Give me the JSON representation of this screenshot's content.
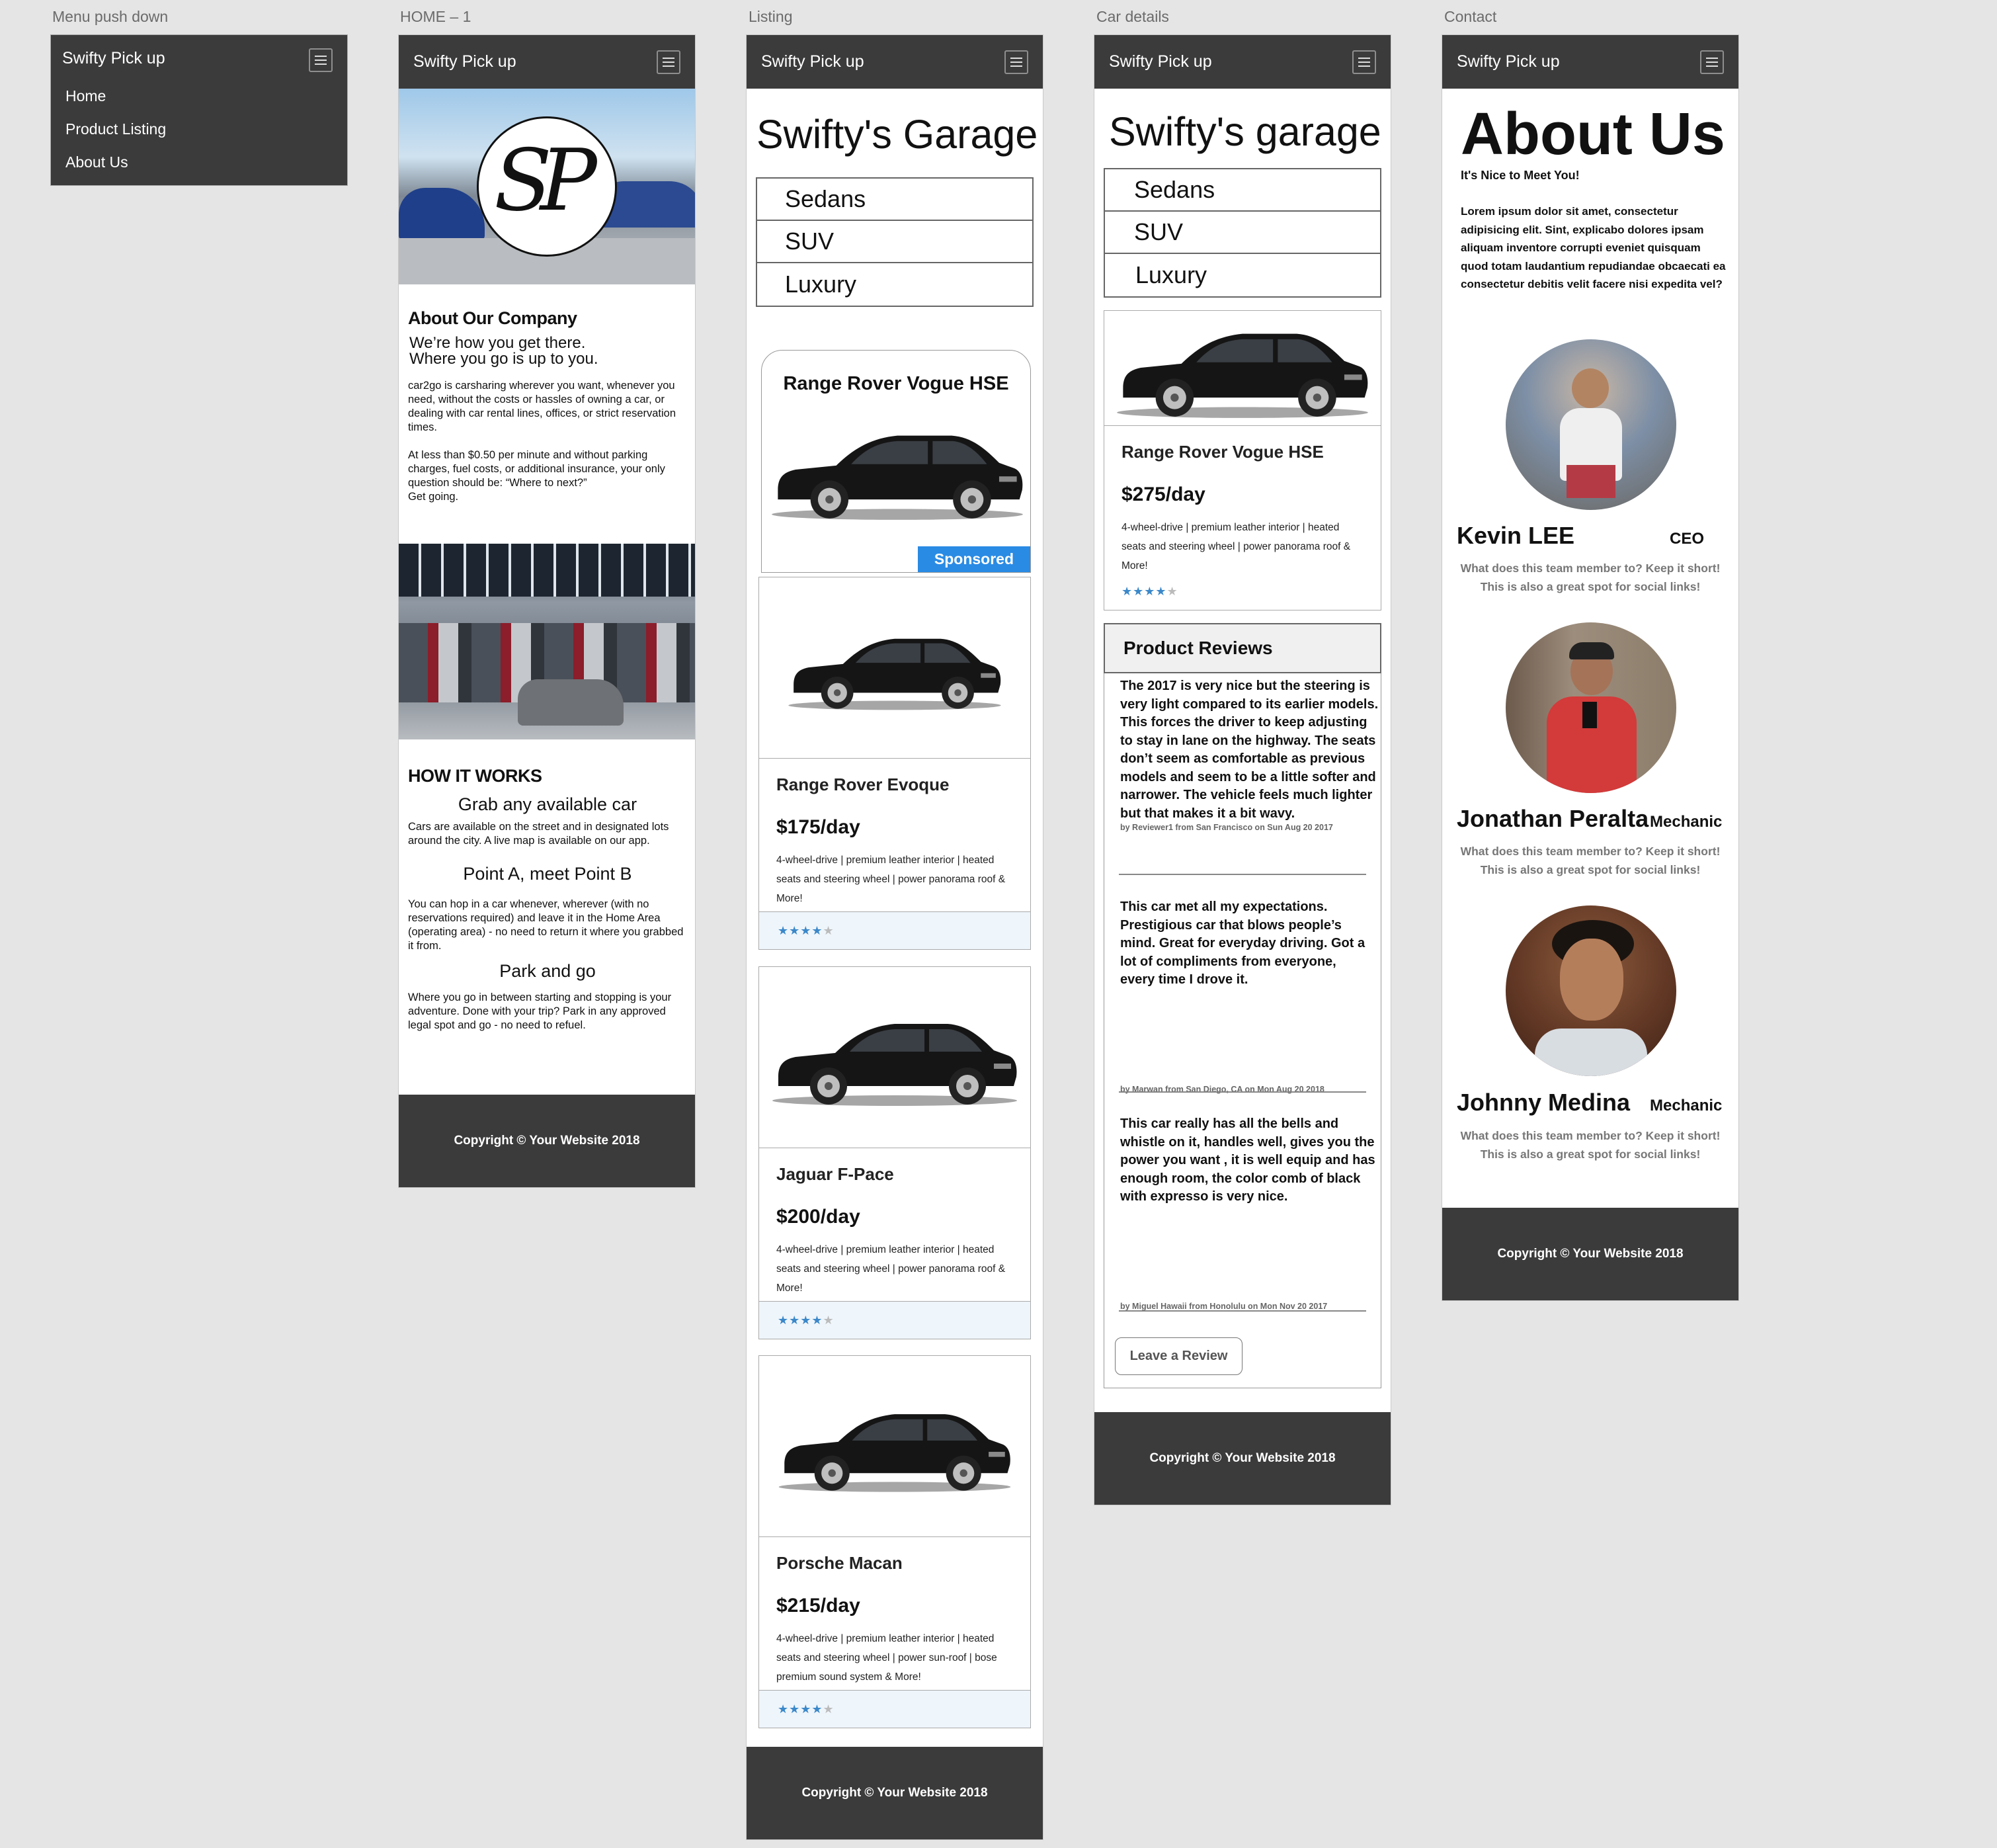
{
  "artboards": {
    "menu": "Menu push down",
    "home": "HOME – 1",
    "listing": "Listing",
    "details": "Car details",
    "contact": "Contact"
  },
  "nav": {
    "brand": "Swifty Pick up",
    "menu_icon": "hamburger-icon"
  },
  "menu": {
    "items": [
      "Home",
      "Product Listing",
      "About Us"
    ]
  },
  "footer": "Copyright © Your Website 2018",
  "home": {
    "logo": "SP",
    "about_title": "About Our Company",
    "lead_1": "We’re how you get there.",
    "lead_2": "Where you go is up to you.",
    "about_p1": "car2go is carsharing wherever you want, whenever you need, without the costs or hassles of owning a car, or dealing with car rental lines, offices, or strict reservation times.",
    "about_p2": "At less than $0.50 per minute and without parking charges, fuel costs, or additional insurance, your only question should be: “Where to next?”",
    "about_p3": "Get going.",
    "how_title": "HOW IT WORKS",
    "steps": [
      {
        "title": "Grab any available car",
        "text": "Cars are available on the street and in designated lots around the city. A live map is available on our app."
      },
      {
        "title": "Point A, meet Point B",
        "text": "You can hop in a car whenever, wherever (with no reservations required) and leave it in the Home Area (operating area) - no need to return it where you grabbed it from."
      },
      {
        "title": "Park and go",
        "text": "Where you go in between starting and stopping is your adventure. Done with your trip? Park in any approved legal spot and go - no need to refuel."
      }
    ]
  },
  "listing": {
    "title": "Swifty's Garage",
    "categories": [
      "Sedans",
      "SUV",
      "Luxury"
    ],
    "sponsored": {
      "name": "Range Rover Vogue HSE",
      "badge": "Sponsored"
    },
    "cars": [
      {
        "name": "Range Rover Evoque",
        "price": "$175/day",
        "desc": "4-wheel-drive | premium leather interior | heated seats and steering wheel | power panorama roof & More!",
        "rating": 4
      },
      {
        "name": "Jaguar F-Pace",
        "price": "$200/day",
        "desc": "4-wheel-drive | premium leather interior | heated seats and steering wheel | power panorama roof & More!",
        "rating": 4
      },
      {
        "name": "Porsche Macan",
        "price": "$215/day",
        "desc": "4-wheel-drive | premium leather interior | heated seats and steering wheel | power sun-roof | bose premium sound system & More!",
        "rating": 4
      }
    ]
  },
  "details": {
    "title": "Swifty's garage",
    "categories": [
      "Sedans",
      "SUV",
      "Luxury"
    ],
    "car": {
      "name": "Range Rover Vogue HSE",
      "price": "$275/day",
      "desc": "4-wheel-drive | premium leather interior | heated seats and steering wheel | power panorama roof & More!",
      "rating": 4
    },
    "reviews_title": "Product Reviews",
    "reviews": [
      {
        "text": "The 2017 is very nice but the steering is very light compared to its earlier models. This forces the driver to keep adjusting to stay in lane on the highway. The seats don’t seem as comfortable as previous models and seem to be a little softer and narrower. The vehicle feels much lighter but that makes it a bit wavy.",
        "by": "by Reviewer1 from San Francisco on Sun Aug 20 2017"
      },
      {
        "text": "This car met all my expectations. Prestigious car that blows people’s mind. Great for everyday driving. Got a lot of compliments from everyone, every time I drove it.",
        "by": "by Marwan from San Diego, CA on Mon Aug 20 2018"
      },
      {
        "text": "This car really has all the bells and whistle on it, handles well, gives you the power you want , it is well equip and has enough room, the color comb of black with expresso is very nice.",
        "by": "by Miguel Hawaii from Honolulu on Mon Nov 20 2017"
      }
    ],
    "leave_review": "Leave a Review"
  },
  "contact": {
    "title": "About Us",
    "subtitle": "It's Nice to Meet You!",
    "body": "Lorem ipsum dolor sit amet, consectetur adipisicing elit. Sint, explicabo dolores ipsam aliquam inventore corrupti eveniet quisquam quod totam laudantium repudiandae obcaecati ea consectetur debitis velit facere nisi expedita vel?",
    "members": [
      {
        "name": "Kevin LEE",
        "role": "CEO",
        "note_1": "What does this team member to? Keep it short!",
        "note_2": "This is also a great spot for social links!"
      },
      {
        "name": "Jonathan Peralta",
        "role": "Mechanic",
        "note_1": "What does this team member to? Keep it short!",
        "note_2": "This is also a great spot for social links!"
      },
      {
        "name": "Johnny Medina",
        "role": "Mechanic",
        "note_1": "What does this team member to? Keep it short!",
        "note_2": "This is also a great spot for social links!"
      }
    ]
  },
  "colors": {
    "nav": "#3b3b3b",
    "accent": "#2a8be4",
    "star": "#3b88c9",
    "background": "#e5e5e5"
  }
}
